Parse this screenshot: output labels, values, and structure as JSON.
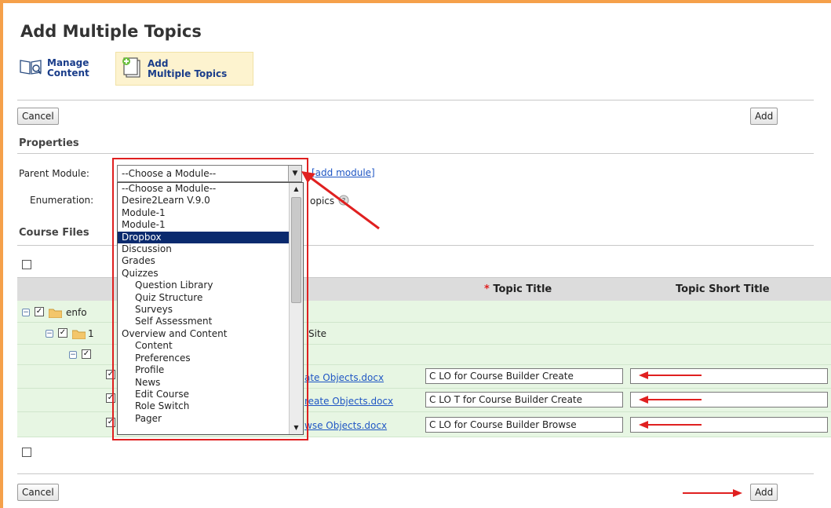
{
  "page_title": "Add Multiple Topics",
  "toolbar": {
    "manage_line1": "Manage",
    "manage_line2": "Content",
    "add_line1": "Add",
    "add_line2": "Multiple Topics"
  },
  "buttons": {
    "cancel": "Cancel",
    "add": "Add"
  },
  "properties": {
    "heading": "Properties",
    "parent_module_label": "Parent Module:",
    "selected_module": "--Choose a Module--",
    "add_module_link": "[add module]",
    "enumeration_label": "Enumeration:",
    "enumeration_suffix": "opics"
  },
  "course_files_heading": "Course Files",
  "dropdown_options": [
    {
      "label": "--Choose a Module--",
      "sub": false,
      "selected": false
    },
    {
      "label": "Desire2Learn V.9.0",
      "sub": false,
      "selected": false
    },
    {
      "label": "Module-1",
      "sub": false,
      "selected": false
    },
    {
      "label": "Module-1",
      "sub": false,
      "selected": false
    },
    {
      "label": "Dropbox",
      "sub": false,
      "selected": true
    },
    {
      "label": "Discussion",
      "sub": false,
      "selected": false
    },
    {
      "label": "Grades",
      "sub": false,
      "selected": false
    },
    {
      "label": "Quizzes",
      "sub": false,
      "selected": false
    },
    {
      "label": "Question Library",
      "sub": true,
      "selected": false
    },
    {
      "label": "Quiz Structure",
      "sub": true,
      "selected": false
    },
    {
      "label": "Surveys",
      "sub": true,
      "selected": false
    },
    {
      "label": "Self Assessment",
      "sub": true,
      "selected": false
    },
    {
      "label": "Overview and Content",
      "sub": false,
      "selected": false
    },
    {
      "label": "Content",
      "sub": true,
      "selected": false
    },
    {
      "label": "Preferences",
      "sub": true,
      "selected": false
    },
    {
      "label": "Profile",
      "sub": true,
      "selected": false
    },
    {
      "label": "News",
      "sub": true,
      "selected": false
    },
    {
      "label": "Edit Course",
      "sub": true,
      "selected": false
    },
    {
      "label": "Role Switch",
      "sub": true,
      "selected": false
    },
    {
      "label": "Pager",
      "sub": true,
      "selected": false
    }
  ],
  "grid": {
    "topic_title_header": "Topic Title",
    "required_mark": "*",
    "short_title_header": "Topic Short Title",
    "folder1_label": "enfo",
    "folder2_label": "1",
    "folder2_suffix": "Site",
    "files": [
      {
        "link": "ate Objects.docx",
        "title": "C  LO  for Course Builder Create"
      },
      {
        "link": "reate Objects.docx",
        "title": "C  LO T for Course Builder Create"
      },
      {
        "link": "wse Objects.docx",
        "title": "C LO  for Course Builder Browse"
      }
    ]
  },
  "colors": {
    "accent_border": "#f5a04a",
    "annotation_red": "#e02020",
    "selected_option": "#0a2a6e",
    "row_green": "#e7f6e3"
  }
}
